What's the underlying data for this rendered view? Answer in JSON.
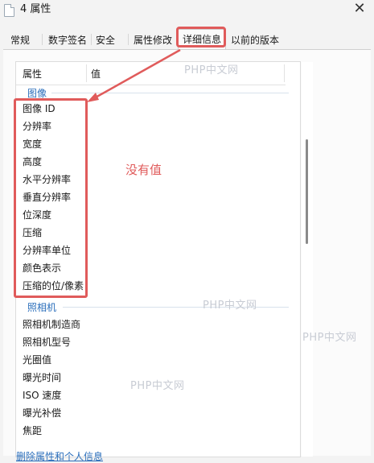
{
  "window": {
    "title": "4 属性",
    "close_glyph": "✕"
  },
  "tabs": [
    {
      "label": "常规"
    },
    {
      "label": "数字签名"
    },
    {
      "label": "安全"
    },
    {
      "label": "属性修改"
    },
    {
      "label": "详细信息",
      "active": true
    },
    {
      "label": "以前的版本"
    }
  ],
  "list": {
    "columns": {
      "property": "属性",
      "value": "值"
    },
    "groups": [
      {
        "name": "图像",
        "rows": [
          "图像 ID",
          "分辨率",
          "宽度",
          "高度",
          "水平分辨率",
          "垂直分辨率",
          "位深度",
          "压缩",
          "分辨率单位",
          "颜色表示",
          "压缩的位/像素"
        ]
      },
      {
        "name": "照相机",
        "rows": [
          "照相机制造商",
          "照相机型号",
          "光圈值",
          "曝光时间",
          "ISO 速度",
          "曝光补偿",
          "焦距"
        ]
      }
    ]
  },
  "annotation": {
    "text": "没有值",
    "color": "#e05b5b"
  },
  "watermark": "PHP中文网",
  "bottom_link": "删除属性和个人信息",
  "colors": {
    "accent": "#2a6ebb",
    "highlight": "#e05b5b"
  }
}
